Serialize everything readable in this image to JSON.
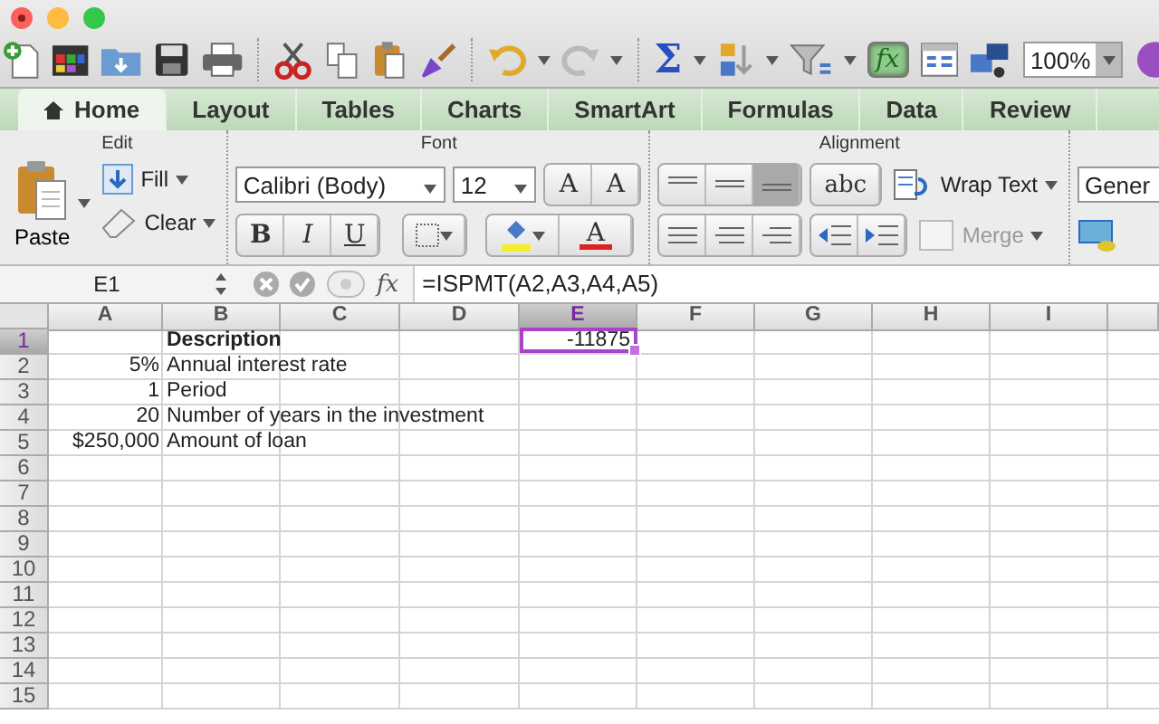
{
  "toolbar": {
    "sum_symbol": "Σ",
    "formula_builder": {
      "label": "fx",
      "on": true
    },
    "zoom": "100%"
  },
  "ribbon_tabs": [
    {
      "label": "Home",
      "selected": true
    },
    {
      "label": "Layout",
      "selected": false
    },
    {
      "label": "Tables",
      "selected": false
    },
    {
      "label": "Charts",
      "selected": false
    },
    {
      "label": "SmartArt",
      "selected": false
    },
    {
      "label": "Formulas",
      "selected": false
    },
    {
      "label": "Data",
      "selected": false
    },
    {
      "label": "Review",
      "selected": false
    }
  ],
  "ribbon": {
    "edit": {
      "title": "Edit",
      "paste": "Paste",
      "fill": "Fill",
      "clear": "Clear"
    },
    "font": {
      "title": "Font",
      "family": "Calibri (Body)",
      "size": "12",
      "grow": "A",
      "shrink": "A",
      "bold": "B",
      "italic": "I",
      "underline": "U",
      "color_letter": "A"
    },
    "alignment": {
      "title": "Alignment",
      "vertical": [
        {
          "selected": false
        },
        {
          "selected": false
        },
        {
          "selected": true
        }
      ],
      "orientation": "abc",
      "wrap_text": "Wrap Text",
      "merge": {
        "label": "Merge",
        "disabled": true
      }
    },
    "number": {
      "format": "Gener"
    }
  },
  "formula_bar": {
    "name_box": "E1",
    "fx": "fx",
    "formula": "=ISPMT(A2,A3,A4,A5)"
  },
  "sheet": {
    "columns": [
      {
        "label": "A",
        "selected": false
      },
      {
        "label": "B",
        "selected": false
      },
      {
        "label": "C",
        "selected": false
      },
      {
        "label": "D",
        "selected": false
      },
      {
        "label": "E",
        "selected": true
      },
      {
        "label": "F",
        "selected": false
      },
      {
        "label": "G",
        "selected": false
      },
      {
        "label": "H",
        "selected": false
      },
      {
        "label": "I",
        "selected": false
      }
    ],
    "rows": [
      {
        "header": "1",
        "selected": true,
        "cells": {
          "B": {
            "text": "Description",
            "kind": "heading",
            "selected": false
          },
          "E": {
            "text": "-11875",
            "kind": "number",
            "selected": true
          }
        }
      },
      {
        "header": "2",
        "selected": false,
        "cells": {
          "A": {
            "text": "5%",
            "kind": "number",
            "selected": false
          },
          "B": {
            "text": "Annual interest rate",
            "kind": "text",
            "selected": false
          }
        }
      },
      {
        "header": "3",
        "selected": false,
        "cells": {
          "A": {
            "text": "1",
            "kind": "number",
            "selected": false
          },
          "B": {
            "text": "Period",
            "kind": "text",
            "selected": false
          }
        }
      },
      {
        "header": "4",
        "selected": false,
        "cells": {
          "A": {
            "text": "20",
            "kind": "number",
            "selected": false
          },
          "B": {
            "text": "Number of years in the investment",
            "kind": "text",
            "selected": false
          }
        }
      },
      {
        "header": "5",
        "selected": false,
        "cells": {
          "A": {
            "text": "$250,000",
            "kind": "number",
            "selected": false
          },
          "B": {
            "text": "Amount of loan",
            "kind": "text",
            "selected": false
          }
        }
      },
      {
        "header": "6",
        "selected": false
      },
      {
        "header": "7",
        "selected": false
      },
      {
        "header": "8",
        "selected": false
      },
      {
        "header": "9",
        "selected": false
      },
      {
        "header": "10",
        "selected": false
      },
      {
        "header": "11",
        "selected": false
      },
      {
        "header": "12",
        "selected": false
      },
      {
        "header": "13",
        "selected": false
      },
      {
        "header": "14",
        "selected": false
      },
      {
        "header": "15",
        "selected": false
      }
    ]
  }
}
